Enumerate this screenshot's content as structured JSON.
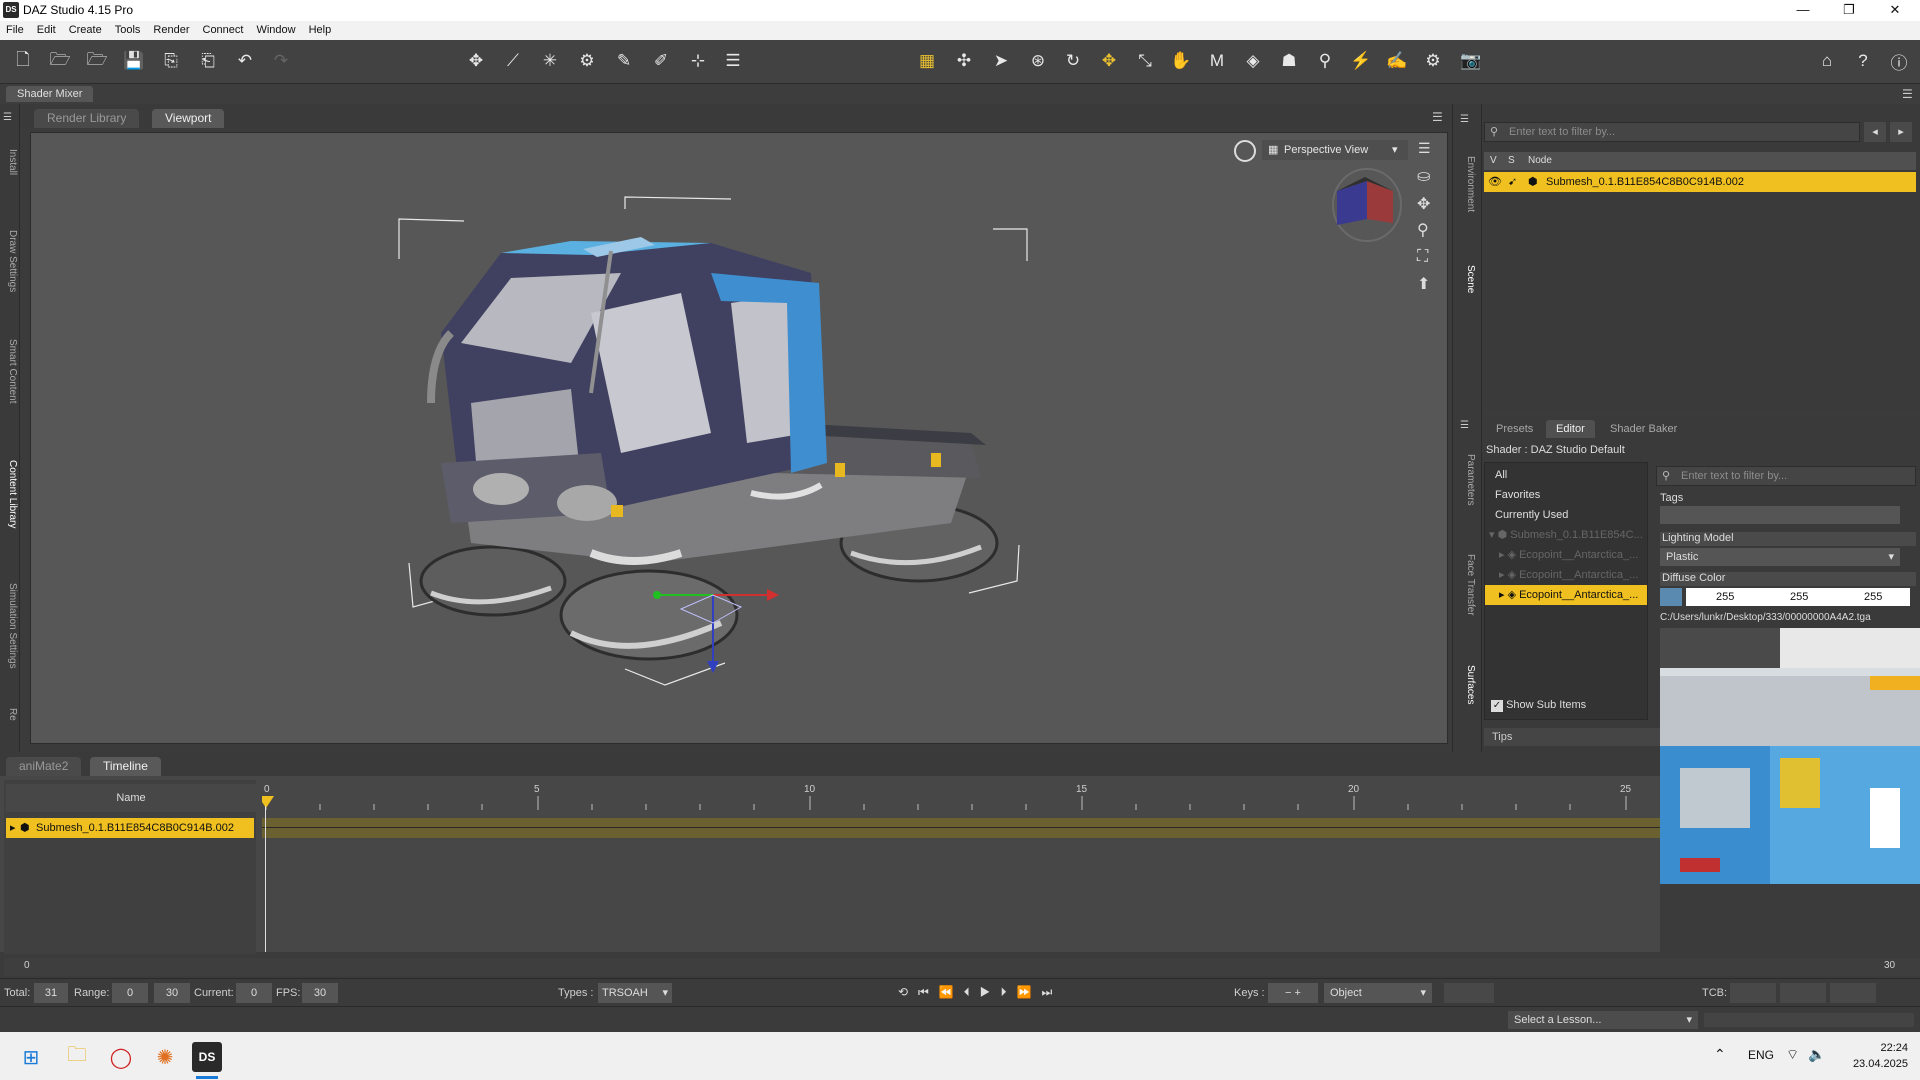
{
  "window": {
    "title": "DAZ Studio 4.15 Pro",
    "logo": "DS",
    "controls": [
      "—",
      "❐",
      "✕"
    ]
  },
  "menu": [
    "File",
    "Edit",
    "Create",
    "Tools",
    "Render",
    "Connect",
    "Window",
    "Help"
  ],
  "shader_mixer_tab": "Shader Mixer",
  "left_tabs": [
    "Install",
    "Draw Settings",
    "Smart Content",
    "Content Library",
    "Simulation Settings",
    "Re"
  ],
  "viewport": {
    "tabs": [
      "Render Library",
      "Viewport"
    ],
    "active_tab": "Viewport",
    "view_select": "Perspective View",
    "bg_color": "#575757"
  },
  "right_strip_tabs_top": [
    "Environment",
    "Scene"
  ],
  "right_strip_tabs_bottom": [
    "Parameters",
    "Face Transfer",
    "Surfaces"
  ],
  "scene": {
    "filter_placeholder": "Enter text to filter by...",
    "columns": [
      "V",
      "S",
      "Node"
    ],
    "row": "Submesh_0.1.B11E854C8B0C914B.002"
  },
  "surfaces": {
    "tabs": [
      "Presets",
      "Editor",
      "Shader Baker"
    ],
    "active_tab": "Editor",
    "shader_label": "Shader : DAZ Studio Default",
    "categories": [
      "All",
      "Favorites",
      "Currently Used"
    ],
    "tree": [
      {
        "label": "Submesh_0.1.B11E854C...",
        "dim": true
      },
      {
        "label": "Ecopoint__Antarctica_...",
        "dim": true
      },
      {
        "label": "Ecopoint__Antarctica_...",
        "dim": true
      },
      {
        "label": "Ecopoint__Antarctica_...",
        "dim": false,
        "selected": true
      }
    ],
    "show_sub_items": "Show Sub Items",
    "tips": "Tips",
    "filter_placeholder": "Enter text to filter by...",
    "tags_label": "Tags",
    "lighting_model_label": "Lighting Model",
    "lighting_model_value": "Plastic",
    "diffuse_label": "Diffuse Color",
    "diffuse_rgb": [
      "255",
      "255",
      "255"
    ],
    "texture_path": "C:/Users/lunkr/Desktop/333/00000000A4A2.tga"
  },
  "timeline": {
    "tabs": [
      "aniMate2",
      "Timeline"
    ],
    "active_tab": "Timeline",
    "name_header": "Name",
    "row": "Submesh_0.1.B11E854C8B0C914B.002",
    "ruler_labels": [
      "0",
      "5",
      "10",
      "15",
      "20",
      "25"
    ],
    "range_start": "0",
    "range_end": "30"
  },
  "status": {
    "total_label": "Total:",
    "total": "31",
    "range_label": "Range:",
    "range_from": "0",
    "range_to": "30",
    "current_label": "Current:",
    "current": "0",
    "fps_label": "FPS:",
    "fps": "30",
    "types_label": "Types :",
    "types_value": "TRSOAH",
    "keys_label": "Keys :",
    "keys_value": "Object",
    "tcb_label": "TCB:"
  },
  "lesson_select": "Select a Lesson...",
  "taskbar": {
    "lang": "ENG",
    "time": "22:24",
    "date": "23.04.2025"
  },
  "accent": "#f0c020"
}
